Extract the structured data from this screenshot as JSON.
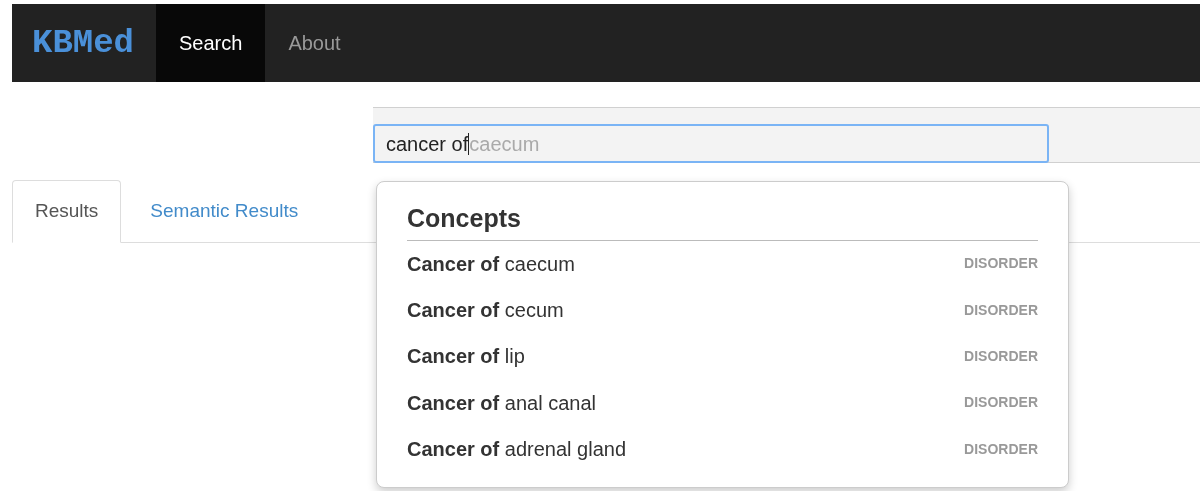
{
  "navbar": {
    "brand": "KBMed",
    "items": [
      {
        "label": "Search",
        "selected": true
      },
      {
        "label": "About",
        "selected": false
      }
    ]
  },
  "search": {
    "value": "cancer of",
    "completion": "caecum"
  },
  "tabs": [
    {
      "label": "Results",
      "selected": true
    },
    {
      "label": "Semantic Results",
      "selected": false
    }
  ],
  "suggestions": {
    "title": "Concepts",
    "items": [
      {
        "label": "**Cancer of** caecum",
        "category": "DISORDER"
      },
      {
        "label": "**Cancer of** cecum",
        "category": "DISORDER"
      },
      {
        "label": "**Cancer of** lip",
        "category": "DISORDER"
      },
      {
        "label": "**Cancer of** anal canal",
        "category": "DISORDER"
      },
      {
        "label": "**Cancer of** adrenal gland",
        "category": "DISORDER"
      }
    ]
  }
}
